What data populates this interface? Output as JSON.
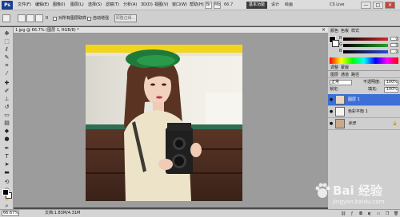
{
  "app": {
    "logo": "Ps"
  },
  "menu": {
    "items": [
      "文件(F)",
      "编辑(E)",
      "图像(I)",
      "图层(L)",
      "选择(S)",
      "滤镜(T)",
      "分析(A)",
      "3D(D)",
      "视图(V)",
      "窗口(W)",
      "帮助(H)"
    ]
  },
  "topbar": {
    "zoom": "66.7",
    "workspace": "基本功能",
    "links": [
      "设计",
      "绘画"
    ],
    "cslive": "CS Live",
    "window_buttons": [
      "—",
      "□",
      "✕"
    ]
  },
  "options": {
    "size": "0",
    "auto_enhance": "对所有图层取样",
    "auto_enhance2": "自动增强",
    "refine_edge": "调整边缘..."
  },
  "document": {
    "tab_title": "1.jpg @ 66.7% (图层 1, RGB/8) *",
    "close": "×",
    "status_zoom": "66.67%",
    "status_info": "文档:1.83M/4.31M"
  },
  "panels": {
    "color_tab": "颜色",
    "swatches_tab": "色板",
    "styles_tab": "样式",
    "adjust_tab": "调整",
    "masks_tab": "蒙版",
    "rgb": [
      {
        "label": "R",
        "value": "0",
        "color": "#d42a2a"
      },
      {
        "label": "G",
        "value": "0",
        "color": "#2aa02a"
      },
      {
        "label": "B",
        "value": "0",
        "color": "#2a4fd4"
      }
    ],
    "layers_tab": "图层",
    "channels_tab": "通道",
    "paths_tab": "路径",
    "blend_mode": "正常",
    "opacity_label": "不透明度:",
    "opacity_value": "100%",
    "lock_label": "锁定:",
    "fill_label": "填充:",
    "fill_value": "100%",
    "layers": [
      {
        "name": "图层 1",
        "selected": true,
        "locked": false
      },
      {
        "name": "色彩平衡 1",
        "selected": false,
        "locked": false
      },
      {
        "name": "背景",
        "selected": false,
        "locked": true
      }
    ],
    "layers_footer_icons": [
      "link-icon",
      "fx-icon",
      "mask-icon",
      "adjust-icon",
      "folder-icon",
      "new-layer-icon",
      "trash-icon"
    ]
  },
  "watermark": {
    "text": "Bai 经验",
    "url": "jingyan.baidu.com"
  },
  "colors": {
    "selected_layer": "#3d6fd6",
    "menu_bg": "#dcdcdc",
    "canvas_bg": "#9c9c9c"
  }
}
